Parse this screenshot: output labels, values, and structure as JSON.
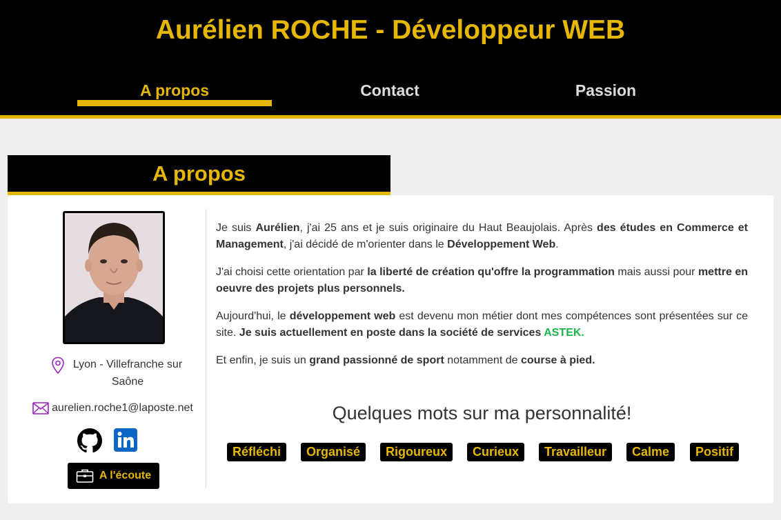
{
  "header": {
    "title": "Aurélien ROCHE - Développeur WEB",
    "nav": [
      {
        "label": "A propos"
      },
      {
        "label": "Contact"
      },
      {
        "label": "Passion"
      }
    ],
    "active_index": 0
  },
  "section": {
    "title": "A propos"
  },
  "sidebar": {
    "location": "Lyon - Villefranche sur Saône",
    "email": "aurelien.roche1@laposte.net",
    "social": [
      {
        "icon": "github-icon"
      },
      {
        "icon": "linkedin-icon"
      }
    ],
    "button_label": "A l'écoute"
  },
  "about": {
    "p1": {
      "a": "Je suis ",
      "b": "Aurélien",
      "c": ", j'ai 25 ans et je suis originaire du Haut Beaujolais. Après ",
      "d": "des études en Commerce et Management",
      "e": ", j'ai décidé de m'orienter dans le ",
      "f": "Développement Web",
      "g": "."
    },
    "p2": {
      "a": "J'ai choisi cette orientation par ",
      "b": "la liberté de création qu'offre la programmation",
      "c": " mais aussi pour ",
      "d": "mettre en oeuvre des projets plus personnels."
    },
    "p3": {
      "a": "Aujourd'hui, le ",
      "b": "développement web",
      "c": " est devenu mon métier dont mes compétences sont présentées sur ce site. ",
      "d": "Je suis actuellement en poste dans la société de services ",
      "e": "ASTEK."
    },
    "p4": {
      "a": "Et enfin, je suis un ",
      "b": "grand passionné de sport",
      "c": " notamment de ",
      "d": "course à pied."
    }
  },
  "personality": {
    "title": "Quelques mots sur ma personnalité!",
    "tags": [
      "Réfléchi",
      "Organisé",
      "Rigoureux",
      "Curieux",
      "Travailleur",
      "Calme",
      "Positif"
    ]
  },
  "colors": {
    "accent": "#e5b700",
    "header_bg": "#000000",
    "astek": "#1eb54a",
    "icon_purple": "#9b1fbf",
    "linkedin": "#0a66c2"
  }
}
